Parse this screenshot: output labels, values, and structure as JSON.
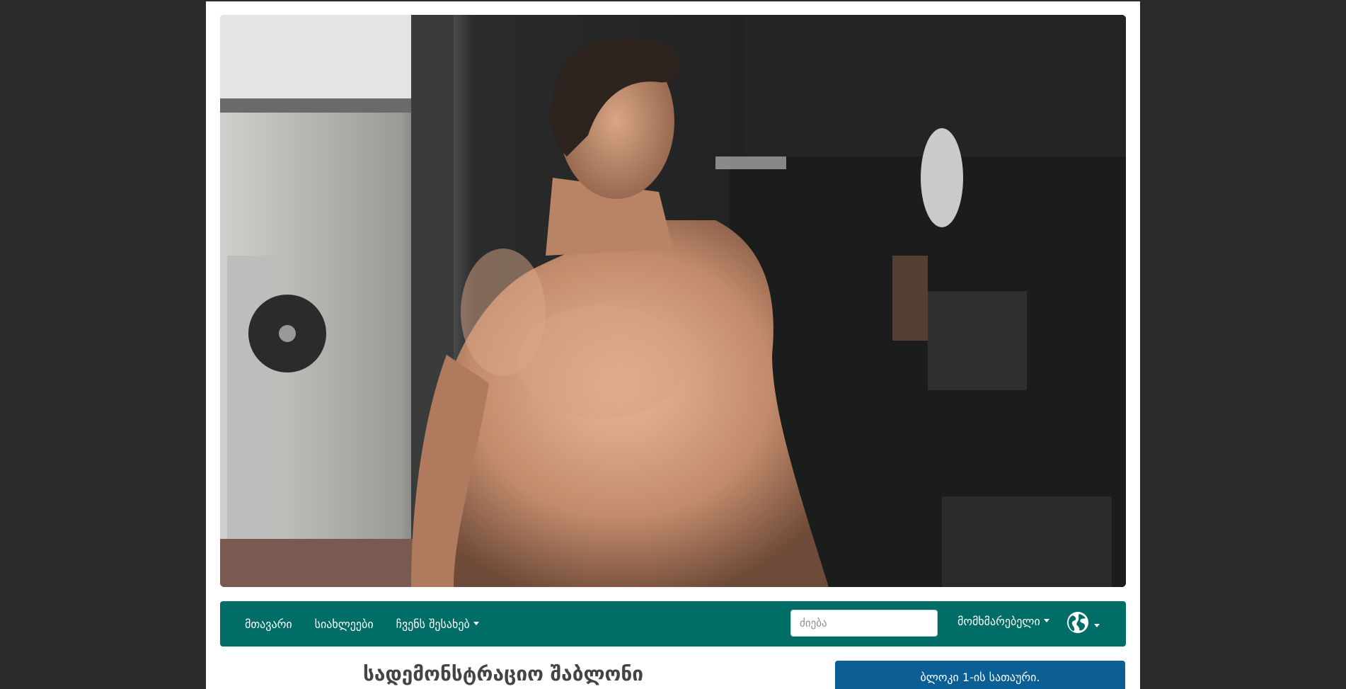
{
  "hero": {
    "image_alt": "Shirtless athlete in a gym"
  },
  "nav": {
    "items": [
      {
        "label": "მთავარი"
      },
      {
        "label": "სიახლეები"
      },
      {
        "label": "ჩვენს შესახებ",
        "has_dropdown": true
      }
    ],
    "search": {
      "placeholder": "ძიება",
      "value": ""
    },
    "user_menu_label": "მომხმარებელი",
    "language_icon": "globe-icon"
  },
  "main": {
    "title": "სადემონსტრაციო შაბლონი"
  },
  "sidebar": {
    "block1_title": "ბლოკი 1-ის სათაური."
  },
  "colors": {
    "page_background": "#2b2b2b",
    "navbar": "#006d67",
    "block_header": "#0c5f94"
  }
}
